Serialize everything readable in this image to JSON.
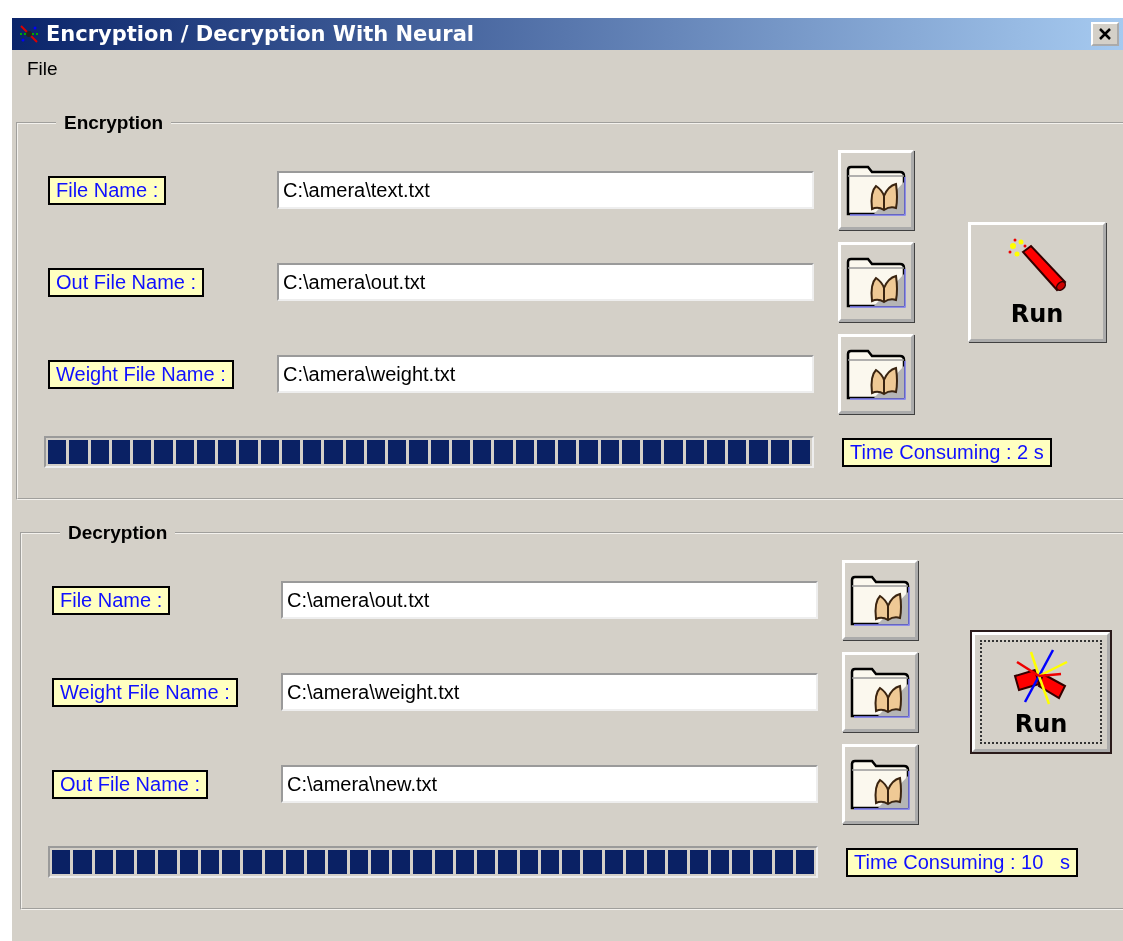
{
  "window": {
    "title": "Encryption / Decryption With Neural"
  },
  "menu": [
    {
      "label": "File"
    }
  ],
  "sections": [
    {
      "title": "Encryption",
      "fields": [
        {
          "label": "File Name :",
          "value": "C:\\amera\\text.txt"
        },
        {
          "label": "Out File Name :",
          "value": "C:\\amera\\out.txt"
        },
        {
          "label": "Weight File Name :",
          "value": "C:\\amera\\weight.txt"
        }
      ],
      "run_button": {
        "label": "Run",
        "focused": false
      },
      "progress": {
        "level": 1
      },
      "time": "Time Consuming : 2 s"
    },
    {
      "title": "Decryption",
      "fields": [
        {
          "label": "File Name :",
          "value": "C:\\amera\\out.txt"
        },
        {
          "label": "Weight File Name :",
          "value": "C:\\amera\\weight.txt"
        },
        {
          "label": "Out File Name :",
          "value": "C:\\amera\\new.txt"
        }
      ],
      "run_button": {
        "label": "Run",
        "focused": true
      },
      "progress": {
        "level": 1
      },
      "time": "Time Consuming : 10   s"
    }
  ]
}
